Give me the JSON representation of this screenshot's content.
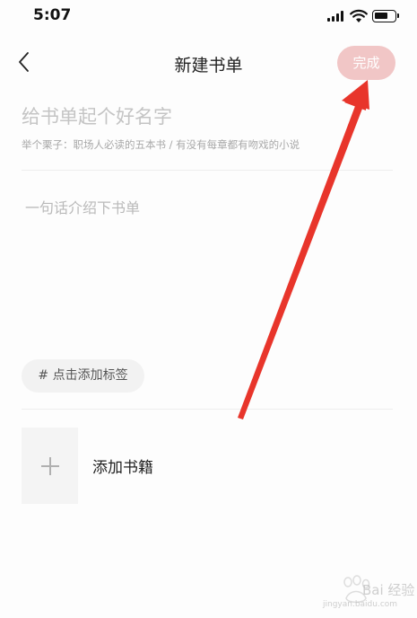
{
  "status_bar": {
    "time": "5:07",
    "icons": [
      "cellular-signal-icon",
      "wifi-icon",
      "battery-icon"
    ]
  },
  "nav": {
    "back_icon": "chevron-left-icon",
    "title": "新建书单",
    "done_label": "完成",
    "done_color": "#f1c6c6"
  },
  "form": {
    "name_placeholder": "给书单起个好名字",
    "name_value": "",
    "example_hint": "举个栗子：职场人必读的五本书 / 有没有每章都有吻戏的小说",
    "intro_placeholder": "一句话介绍下书单",
    "intro_value": "",
    "tag_label": "# 点击添加标签"
  },
  "books": {
    "add_icon": "plus-icon",
    "add_label": "添加书籍"
  },
  "annotation": {
    "arrow_color": "#e8352b"
  },
  "watermark": {
    "text": "Bai 经验",
    "sub": "jingyan.baidu.com"
  }
}
